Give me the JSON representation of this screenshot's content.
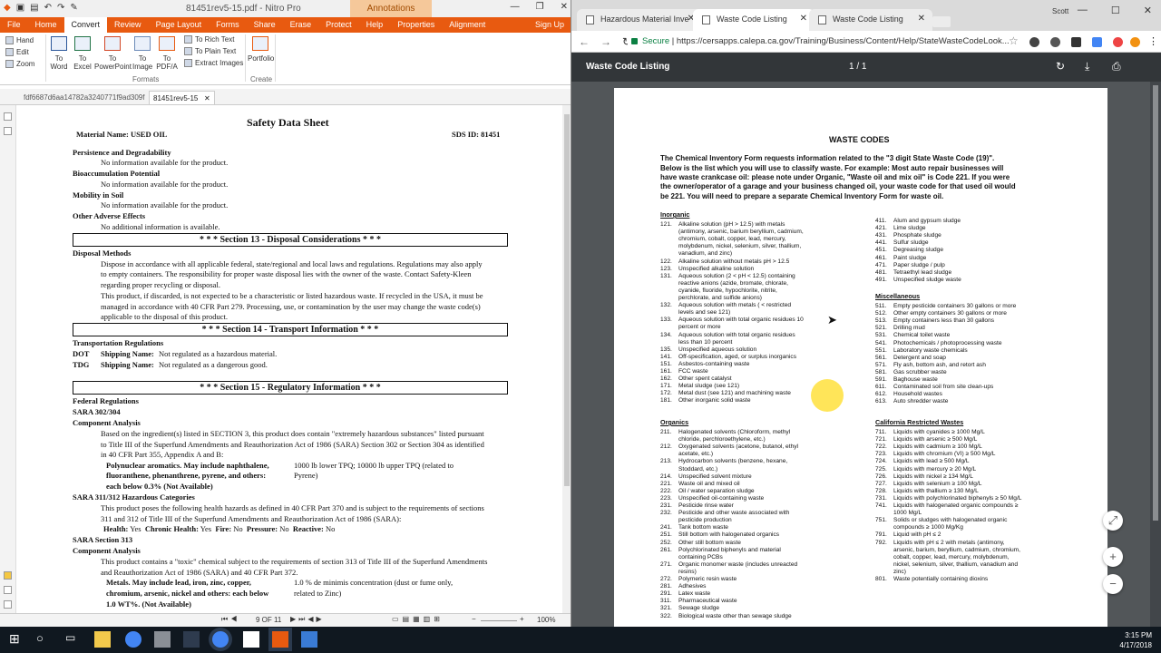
{
  "nitro": {
    "quick_access": [
      "▣",
      "▤",
      "↶",
      "↷",
      "✎"
    ],
    "title": "81451rev5-15.pdf - Nitro Pro",
    "contextual_tab": "Annotations",
    "menu": [
      "File",
      "Home",
      "Convert",
      "Review",
      "Page Layout",
      "Forms",
      "Share",
      "Erase",
      "Protect",
      "Help",
      "Properties",
      "Alignment"
    ],
    "sign_up": "Sign Up",
    "ribbon": {
      "hand": "Hand",
      "edit": "Edit",
      "zoom": "Zoom",
      "to_word": "To Word",
      "to_excel": "To Excel",
      "to_powerpoint": "To PowerPoint",
      "to_image": "To Image",
      "to_pdfa": "To PDF/A",
      "to_rich_text": "To Rich Text",
      "to_plain_text": "To Plain Text",
      "extract_images": "Extract Images",
      "portfolio": "Portfolio",
      "group_formats": "Formats",
      "group_create": "Create"
    },
    "doc_tabs": [
      "fdf6687d6aa14782a3240771f9ad309f",
      "81451rev5-15"
    ],
    "status": {
      "page": "9 OF 11",
      "zoom": "100%"
    }
  },
  "sds": {
    "title": "Safety Data Sheet",
    "material": "Material Name: USED OIL",
    "sds_id": "SDS ID: 81451",
    "persistence_h": "Persistence and Degradability",
    "persistence_t": "No information available for the product.",
    "bioacc_h": "Bioaccumulation Potential",
    "bioacc_t": "No information available for the product.",
    "mobility_h": "Mobility in Soil",
    "mobility_t": "No information available for the product.",
    "adverse_h": "Other Adverse Effects",
    "adverse_t": "No additional information is available.",
    "sec13": "* * *   Section 13 - Disposal Considerations   * * *",
    "disposal_h": "Disposal Methods",
    "disposal_p1": [
      "Dispose in accordance with all applicable federal, state/regional and local laws and regulations. Regulations may also apply",
      "to empty containers.  The responsibility for proper waste disposal lies with the owner of the waste.  Contact Safety-Kleen",
      "regarding proper recycling or disposal."
    ],
    "disposal_p2": [
      "This product, if discarded, is not expected to be a characteristic or listed hazardous waste.  If recycled in the USA, it must be",
      "managed in accordance with 40 CFR Part 279.  Processing, use, or contamination by the user may change the waste code(s)",
      "applicable to the disposal of this product."
    ],
    "sec14": "* * *   Section 14 - Transport Information   * * *",
    "transport_h": "Transportation Regulations",
    "dot_l": "DOT",
    "dot_s": "Shipping Name:",
    "dot_v": "Not regulated as a hazardous material.",
    "tdg_l": "TDG",
    "tdg_s": "Shipping Name:",
    "tdg_v": "Not regulated as a dangerous good.",
    "sec15": "* * *   Section 15 - Regulatory Information   * * *",
    "federal_h": "Federal Regulations",
    "sara302_h": "SARA 302/304",
    "comp_h": "Component Analysis",
    "sara302_p": [
      "Based on the ingredient(s) listed in SECTION 3, this product does contain \"extremely hazardous substances\" listed pursuant",
      "to Title III of the Superfund Amendments and Reauthorization Act of 1986 (SARA) Section 302 or Section 304 as identified",
      "in 40 CFR Part 355, Appendix A and B:"
    ],
    "pah_l": [
      "Polynuclear aromatics.  May include naphthalene,",
      "fluoranthene, phenanthrene, pyrene, and others:",
      "each below 0.3% (Not Available)"
    ],
    "pah_r": [
      "1000 lb lower TPQ; 10000 lb upper TPQ (related to",
      "Pyrene)"
    ],
    "sara311_h": "SARA 311/312 Hazardous Categories",
    "sara311_p": [
      "This product poses the following health hazards as defined in 40 CFR Part 370 and is subject to the requirements of sections",
      "311 and 312 of Title III of the Superfund Amendments and Reauthorization Act of 1986 (SARA):"
    ],
    "hazards": [
      "Health:",
      "Yes",
      "Chronic Health:",
      "Yes",
      "Fire:",
      "No",
      "Pressure:",
      "No",
      "Reactive:",
      "No"
    ],
    "sara313_h": "SARA Section 313",
    "comp2_h": "Component Analysis",
    "sara313_p": [
      "This product contains a \"toxic\" chemical subject to the requirements of section 313 of Title III of the Superfund Amendments",
      "and Reauthorization Act of 1986 (SARA) and 40 CFR Part 372."
    ],
    "metals_l": [
      "Metals.  May include lead, iron, zinc, copper,",
      "chromium, arsenic, nickel and others:  each below",
      "1.0 WT%. (Not Available)"
    ],
    "metals_r": [
      "1.0 % de minimis concentration (dust or fume only,",
      "related to Zinc)"
    ]
  },
  "chrome": {
    "tabs": [
      "Hazardous Material Inve",
      "Waste Code Listing",
      "Waste Code Listing"
    ],
    "user": "Scott",
    "secure": "Secure",
    "url": "https://cersapps.calepa.ca.gov/Training/Business/Content/Help/StateWasteCodeLook...",
    "pdf_title": "Waste Code Listing",
    "pdf_pages": "1  /  1"
  },
  "waste": {
    "title": "WASTE CODES",
    "intro": [
      "The Chemical Inventory Form requests information related to the \"3 digit State Waste Code (19)\".",
      "Below is the list which you will use to classify waste.  For example:  Most auto repair businesses will",
      "have waste crankcase oil:  please note under Organic, \"Waste oil and mix oil\" is Code 221.  If you were",
      "the owner/operator of a garage and your business changed oil, your waste code for that used oil would",
      "be 221.  You will need to prepare a separate Chemical Inventory Form for waste oil."
    ],
    "inorganic_h": "Inorganic",
    "inorganic": [
      [
        "121.",
        "Alkaline solution (pH > 12.5) with metals"
      ],
      [
        "",
        "(antimony, arsenic, barium beryllium, cadmium,"
      ],
      [
        "",
        "chromium, cobalt, copper, lead, mercury,"
      ],
      [
        "",
        "molybdenum, nickel, selenium, silver, thallium,"
      ],
      [
        "",
        "vanadium, and zinc)"
      ],
      [
        "122.",
        "Alkaline solution without metals pH > 12.5"
      ],
      [
        "123.",
        "Unspecified alkaline solution"
      ],
      [
        "131.",
        "Aqueous solution (2 < pH < 12.5) containing"
      ],
      [
        "",
        "reactive anions (azide, bromate, chlorate,"
      ],
      [
        "",
        "cyanide, fluoride, hypochlorite, nitrite,"
      ],
      [
        "",
        "perchlorate, and sulfide anions)"
      ],
      [
        "132.",
        "Aqueous solution with metals ( < restricted"
      ],
      [
        "",
        "levels and see 121)"
      ],
      [
        "133.",
        "Aqueous solution with total organic residues 10"
      ],
      [
        "",
        "percent or more"
      ],
      [
        "134.",
        "Aqueous solution with total organic residues"
      ],
      [
        "",
        "less than 10 percent"
      ],
      [
        "135.",
        "Unspecified aqueous solution"
      ],
      [
        "141.",
        "Off-specification, aged, or surplus inorganics"
      ],
      [
        "151.",
        "Asbestos-containing waste"
      ],
      [
        "161.",
        "FCC waste"
      ],
      [
        "162.",
        "Other spent catalyst"
      ],
      [
        "171.",
        "Metal sludge (see 121)"
      ],
      [
        "172.",
        "Metal dust (see 121) and machining waste"
      ],
      [
        "181.",
        "Other inorganic solid waste"
      ]
    ],
    "organics_h": "Organics",
    "organics": [
      [
        "211.",
        "Halogenated solvents (Chloroform, methyl"
      ],
      [
        "",
        "chloride, perchloroethylene, etc.)"
      ],
      [
        "212.",
        "Oxygenated solvents (acetone, butanol, ethyl"
      ],
      [
        "",
        "acetate, etc.)"
      ],
      [
        "213.",
        "Hydrocarbon solvents (benzene, hexane,"
      ],
      [
        "",
        "Stoddard, etc.)"
      ],
      [
        "214.",
        "Unspecified solvent mixture"
      ],
      [
        "221.",
        "Waste oil and mixed oil"
      ],
      [
        "222.",
        "Oil / water separation sludge"
      ],
      [
        "223.",
        "Unspecified oil-containing waste"
      ],
      [
        "231.",
        "Pesticide rinse water"
      ],
      [
        "232.",
        "Pesticide and other waste associated with"
      ],
      [
        "",
        "pesticide production"
      ],
      [
        "241.",
        "Tank bottom waste"
      ],
      [
        "251.",
        "Still bottom with halogenated organics"
      ],
      [
        "252.",
        "Other still bottom waste"
      ],
      [
        "261.",
        "Polychlorinated biphenyls and material"
      ],
      [
        "",
        "containing PCBs"
      ],
      [
        "271.",
        "Organic monomer waste (includes unreacted"
      ],
      [
        "",
        "resins)"
      ],
      [
        "272.",
        "Polymeric resin waste"
      ],
      [
        "281.",
        "Adhesives"
      ],
      [
        "291.",
        "Latex waste"
      ],
      [
        "311.",
        "Pharmaceutical waste"
      ],
      [
        "321.",
        "Sewage sludge"
      ],
      [
        "322.",
        "Biological waste other than sewage sludge"
      ]
    ],
    "right_top": [
      [
        "411.",
        "Alum and gypsum sludge"
      ],
      [
        "421.",
        "Lime sludge"
      ],
      [
        "431.",
        "Phosphate sludge"
      ],
      [
        "441.",
        "Sulfur sludge"
      ],
      [
        "451.",
        "Degreasing sludge"
      ],
      [
        "461.",
        "Paint sludge"
      ],
      [
        "471.",
        "Paper sludge / pulp"
      ],
      [
        "481.",
        "Tetraethyl lead sludge"
      ],
      [
        "491.",
        "Unspecified sludge waste"
      ]
    ],
    "misc_h": "Miscellaneous",
    "misc": [
      [
        "511.",
        "Empty pesticide containers 30 gallons or more"
      ],
      [
        "512.",
        "Other empty containers 30 gallons or more"
      ],
      [
        "513.",
        "Empty containers less than 30 gallons"
      ],
      [
        "521.",
        "Drilling mud"
      ],
      [
        "531.",
        "Chemical toilet waste"
      ],
      [
        "541.",
        "Photochemicals / photoprocessing waste"
      ],
      [
        "551.",
        "Laboratory waste chemicals"
      ],
      [
        "561.",
        "Detergent and soap"
      ],
      [
        "571.",
        "Fly ash, bottom ash, and retort ash"
      ],
      [
        "581.",
        "Gas scrubber waste"
      ],
      [
        "591.",
        "Baghouse waste"
      ],
      [
        "611.",
        "Contaminated soil from site clean-ups"
      ],
      [
        "612.",
        "Household wastes"
      ],
      [
        "613.",
        "Auto shredder waste"
      ]
    ],
    "calif_h": "California Restricted Wastes",
    "calif": [
      [
        "711.",
        "Liquids with cyanides ≥ 1000 Mg/L"
      ],
      [
        "721.",
        "Liquids with arsenic ≥ 500 Mg/L"
      ],
      [
        "722.",
        "Liquids with cadmium ≥ 100 Mg/L"
      ],
      [
        "723.",
        "Liquids with chromium (VI) ≥ 500 Mg/L"
      ],
      [
        "724.",
        "Liquids with lead ≥ 500 Mg/L"
      ],
      [
        "725.",
        "Liquids with mercury ≥ 20 Mg/L"
      ],
      [
        "726.",
        "Liquids with nickel ≥ 134 Mg/L"
      ],
      [
        "727.",
        "Liquids with selenium ≥ 100 Mg/L"
      ],
      [
        "728.",
        "Liquids with thallium ≥ 130 Mg/L"
      ],
      [
        "731.",
        "Liquids with polychlorinated biphenyls ≥ 50 Mg/L"
      ],
      [
        "741.",
        "Liquids with halogenated organic compounds ≥"
      ],
      [
        "",
        "1000 Mg/L"
      ],
      [
        "751.",
        "Solids or sludges with halogenated organic"
      ],
      [
        "",
        "compounds ≥ 1000 Mg/Kg"
      ],
      [
        "791.",
        "Liquid with pH ≤ 2"
      ],
      [
        "792.",
        "Liquids with pH ≤ 2 with metals (antimony,"
      ],
      [
        "",
        "arsenic, barium, beryllium, cadmium, chromium,"
      ],
      [
        "",
        "cobalt, copper, lead, mercury, molybdenum,"
      ],
      [
        "",
        "nickel, selenium, silver, thallium, vanadium and"
      ],
      [
        "",
        "zinc)"
      ],
      [
        "801.",
        "Waste potentially containing dioxins"
      ]
    ]
  },
  "taskbar": {
    "time": "3:15 PM",
    "date": "4/17/2018"
  }
}
